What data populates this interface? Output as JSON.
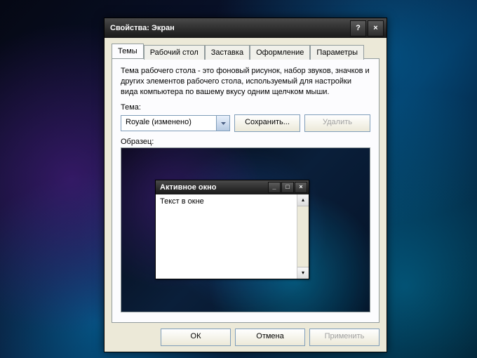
{
  "window": {
    "title": "Свойства: Экран",
    "help_tooltip": "?",
    "close_tooltip": "×"
  },
  "tabs": [
    {
      "label": "Темы",
      "active": true
    },
    {
      "label": "Рабочий стол",
      "active": false
    },
    {
      "label": "Заставка",
      "active": false
    },
    {
      "label": "Оформление",
      "active": false
    },
    {
      "label": "Параметры",
      "active": false
    }
  ],
  "theme_tab": {
    "description": "Тема рабочего стола - это фоновый рисунок, набор звуков, значков и других элементов рабочего стола, используемый для настройки вида компьютера по вашему вкусу одним щелчком мыши.",
    "theme_label": "Тема:",
    "theme_value": "Royale (изменено)",
    "save_button": "Сохранить...",
    "delete_button": "Удалить",
    "sample_label": "Образец:"
  },
  "preview_window": {
    "title": "Активное окно",
    "body_text": "Текст в окне"
  },
  "footer": {
    "ok": "ОК",
    "cancel": "Отмена",
    "apply": "Применить"
  }
}
